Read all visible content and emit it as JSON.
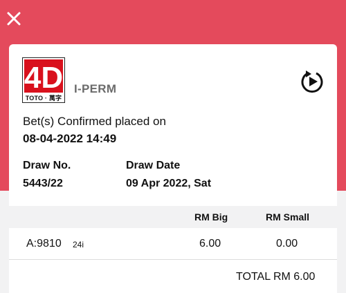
{
  "header": {
    "close_icon": "close-icon",
    "accent_color": "#e44a5c"
  },
  "ticket": {
    "logo_main": "4D",
    "logo_foot": "TOTO · 萬字",
    "game_name": "I-PERM",
    "replay_icon": "replay-icon",
    "confirm_text": "Bet(s) Confirmed placed on",
    "confirm_datetime": "08-04-2022 14:49",
    "draw_no_label": "Draw No.",
    "draw_no": "5443/22",
    "draw_date_label": "Draw Date",
    "draw_date": "09 Apr 2022, Sat"
  },
  "table": {
    "columns": [
      "RM Big",
      "RM Small"
    ],
    "rows": [
      {
        "number": "A:9810",
        "sub": "24i",
        "big": "6.00",
        "small": "0.00"
      }
    ],
    "total": "TOTAL RM 6.00"
  }
}
